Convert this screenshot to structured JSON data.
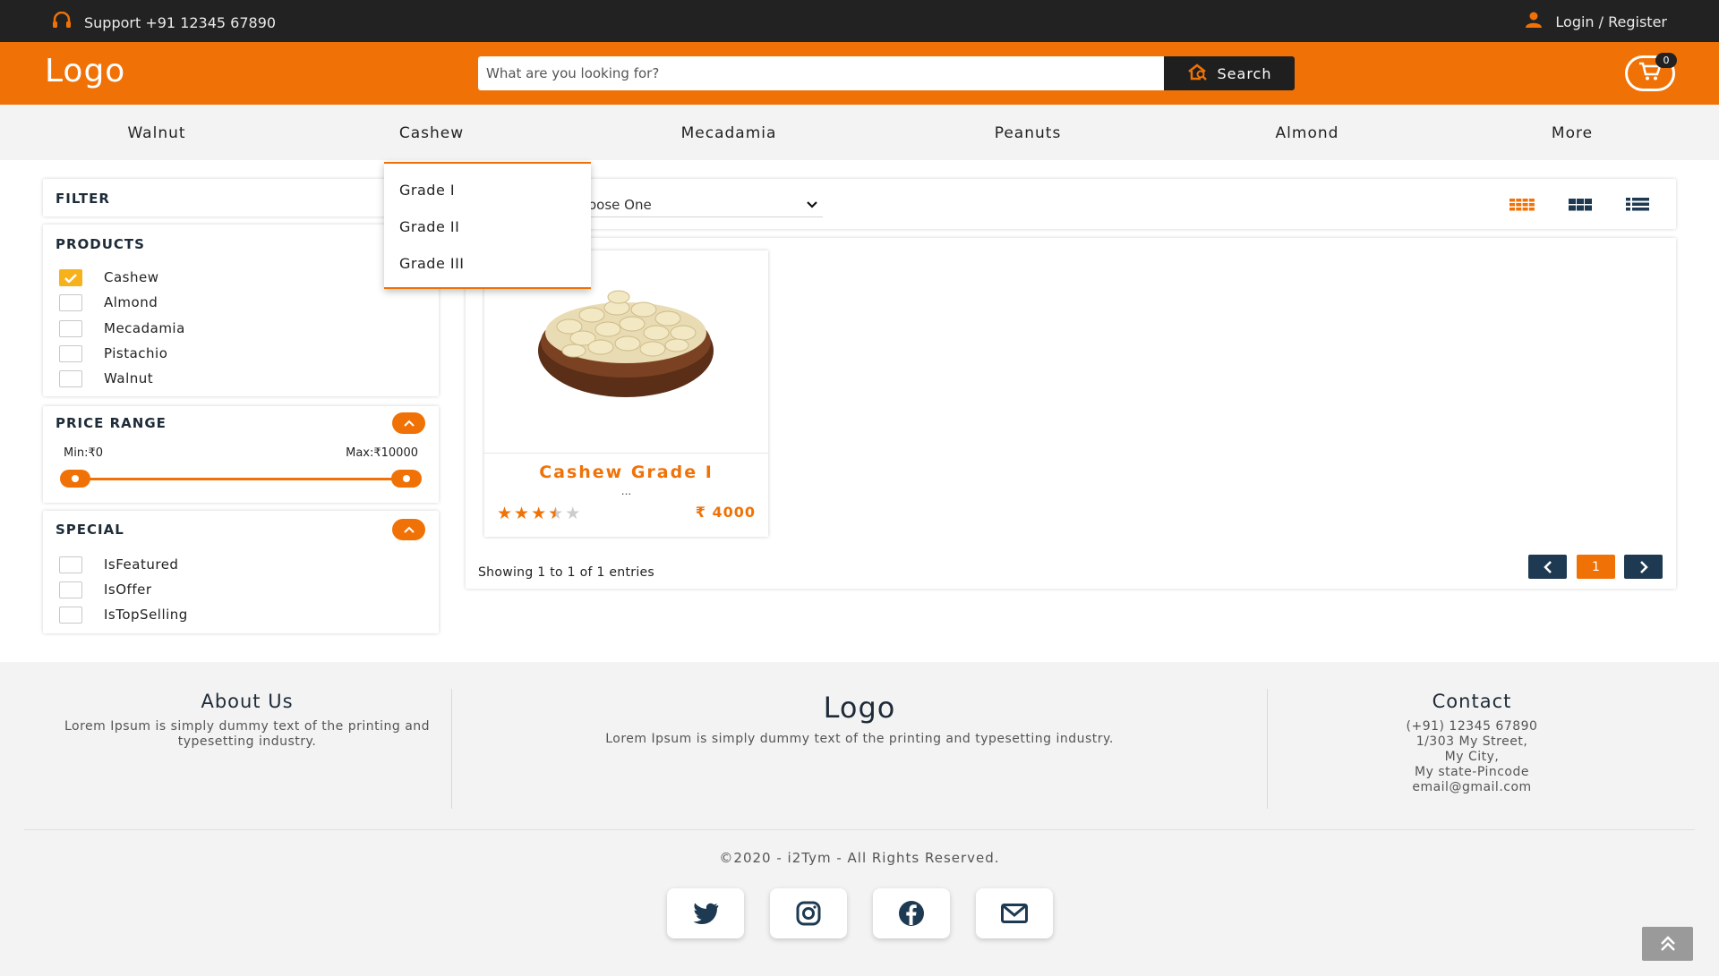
{
  "topbar": {
    "support_text": "Support +91 12345 67890",
    "login_text": "Login / Register"
  },
  "header": {
    "logo": "Logo",
    "search_placeholder": "What are you looking for?",
    "search_button": "Search",
    "cart_count": "0"
  },
  "nav": {
    "items": [
      "Walnut",
      "Cashew",
      "Mecadamia",
      "Peanuts",
      "Almond",
      "More"
    ]
  },
  "dropdown": {
    "items": [
      "Grade I",
      "Grade II",
      "Grade III"
    ]
  },
  "sidebar": {
    "filter_title": "FILTER",
    "products_title": "PRODUCTS",
    "products": [
      {
        "label": "Cashew",
        "checked": true
      },
      {
        "label": "Almond",
        "checked": false
      },
      {
        "label": "Mecadamia",
        "checked": false
      },
      {
        "label": "Pistachio",
        "checked": false
      },
      {
        "label": "Walnut",
        "checked": false
      }
    ],
    "price_title": "PRICE RANGE",
    "price_min": "Min:₹0",
    "price_max": "Max:₹10000",
    "special_title": "SPECIAL",
    "special": [
      {
        "label": "IsFeatured",
        "checked": false
      },
      {
        "label": "IsOffer",
        "checked": false
      },
      {
        "label": "IsTopSelling",
        "checked": false
      }
    ]
  },
  "toolbar": {
    "sort_value": "oose One"
  },
  "product": {
    "name": "Cashew Grade I",
    "description": "...",
    "rating": 3.5,
    "rating_max": 5,
    "price": "₹ 4000"
  },
  "listing": {
    "showing": "Showing 1 to 1 of 1 entries",
    "current_page": "1"
  },
  "footer": {
    "about_title": "About Us",
    "about_text": "Lorem Ipsum is simply dummy text of the printing and typesetting industry.",
    "logo": "Logo",
    "logo_text": "Lorem Ipsum is simply dummy text of the printing and typesetting industry.",
    "contact_title": "Contact",
    "contact_lines": [
      "(+91) 12345 67890",
      "1/303 My Street,",
      "My City,",
      "My state-Pincode",
      "email@gmail.com"
    ],
    "copyright": "©2020 - i2Tym - All Rights Reserved."
  },
  "colors": {
    "accent": "#f07207",
    "dark": "#222222",
    "navy": "#1e3a52",
    "star_gold": "#f07207"
  }
}
